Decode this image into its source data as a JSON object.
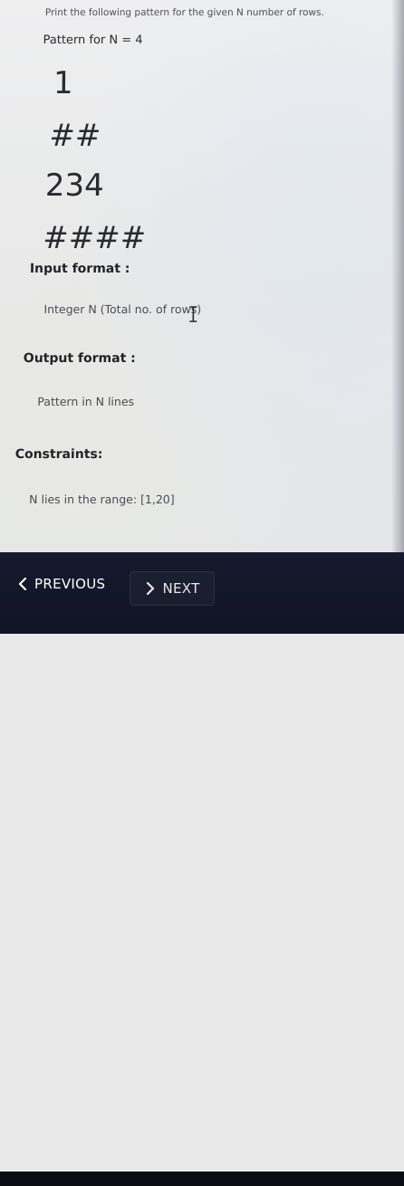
{
  "problem": {
    "intro": "Print the following pattern for the given N number of rows.",
    "pattern_title": "Pattern for N = 4",
    "pattern_rows": [
      "1",
      "##",
      "234",
      "####"
    ]
  },
  "sections": {
    "input_title": "Input format :",
    "input_value": "Integer N (Total no. of rows)",
    "output_title": "Output format :",
    "output_value": "Pattern in N lines",
    "constraints_title": "Constraints:",
    "constraints_value": "N lies in the range: [1,20]"
  },
  "nav": {
    "previous_label": "PREVIOUS",
    "next_label": "NEXT"
  },
  "colors": {
    "nav_background": "#131829",
    "text": "#2c2c30"
  },
  "icons": {
    "cursor": "text-cursor-icon",
    "previous": "chevron-left-icon",
    "next": "chevron-right-icon"
  }
}
